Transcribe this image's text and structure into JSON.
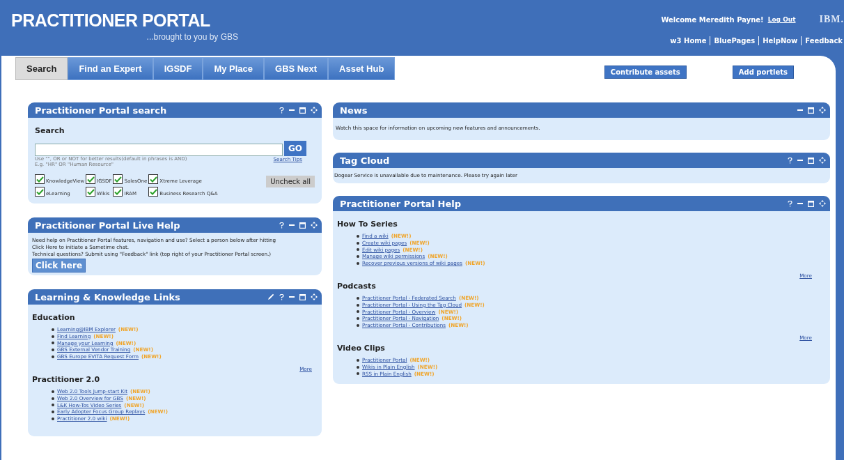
{
  "header": {
    "title": "PRACTITIONER PORTAL",
    "subtitle": "...brought to you by GBS",
    "welcome": "Welcome Meredith Payne!",
    "logout": "Log Out",
    "logo": "IBM.",
    "links": [
      "w3 Home",
      "BluePages",
      "HelpNow",
      "Feedback"
    ]
  },
  "tabs": [
    {
      "label": "Search",
      "selected": true
    },
    {
      "label": "Find an Expert",
      "selected": false
    },
    {
      "label": "IGSDF",
      "selected": false
    },
    {
      "label": "My Place",
      "selected": false
    },
    {
      "label": "GBS Next",
      "selected": false
    },
    {
      "label": "Asset Hub",
      "selected": false
    }
  ],
  "actions": [
    "Contribute assets",
    "Add portlets"
  ],
  "search_panel": {
    "title": "Practitioner Portal search",
    "controls": [
      {
        "kind": "help"
      },
      {
        "kind": "minimize"
      },
      {
        "kind": "maximize"
      },
      {
        "kind": "move"
      }
    ],
    "heading": "Search",
    "go": "GO",
    "hint": "Use \"\", OR or NOT for better results(default in phrases is AND)",
    "example": "E.g. \"HR\" OR \"Human Resource\"",
    "tips": "Search Tips",
    "uncheck_all": "Uncheck all",
    "sources": [
      {
        "label": "KnowledgeView",
        "checked": true
      },
      {
        "label": "IGSDF",
        "checked": true
      },
      {
        "label": "SalesOne",
        "checked": true
      },
      {
        "label": "Xtreme Leverage",
        "checked": true
      },
      {
        "label": "eLearning",
        "checked": true
      },
      {
        "label": "Wikis",
        "checked": true
      },
      {
        "label": "IRAM",
        "checked": true
      },
      {
        "label": "Business Research Q&A",
        "checked": true
      }
    ]
  },
  "live_help": {
    "title": "Practitioner Portal Live Help",
    "controls": [
      {
        "kind": "help"
      },
      {
        "kind": "minimize"
      },
      {
        "kind": "maximize"
      },
      {
        "kind": "move"
      }
    ],
    "lines": [
      "Need help on Practitioner Portal features, navigation and use? Select a person below after hitting",
      "Click Here to initiate a Sametime chat.",
      "Technical questions? Submit using \"Feedback\" link (top right of your Practitioner Portal screen.)"
    ],
    "button": "Click here"
  },
  "learning_links": {
    "title": "Learning & Knowledge Links",
    "controls": [
      {
        "kind": "edit"
      },
      {
        "kind": "help"
      },
      {
        "kind": "minimize"
      },
      {
        "kind": "maximize"
      },
      {
        "kind": "move"
      }
    ],
    "sections": [
      {
        "heading": "Education",
        "more": "More",
        "items": [
          {
            "link": "Learning@IBM Explorer",
            "badge": "(NEW!)"
          },
          {
            "link": "Find Learning",
            "badge": "(NEW!)"
          },
          {
            "link": "Manage your Learning",
            "badge": "(NEW!)"
          },
          {
            "link": "GBS External Vendor Training",
            "badge": "(NEW!)"
          },
          {
            "link": "GBS Europe EVITA Request Form",
            "badge": "(NEW!)"
          }
        ]
      },
      {
        "heading": "Practitioner 2.0",
        "items": [
          {
            "link": "Web 2.0 Tools Jump-start Kit",
            "badge": "(NEW!)"
          },
          {
            "link": "Web 2.0 Overview for GBS",
            "badge": "(NEW!)"
          },
          {
            "link": "L&K How-Tos Video Series",
            "badge": "(NEW!)"
          },
          {
            "link": "Early Adopter Focus Group Replays",
            "badge": "(NEW!)"
          },
          {
            "link": "Practitioner 2.0 wiki",
            "badge": "(NEW!)"
          }
        ]
      }
    ]
  },
  "news": {
    "title": "News",
    "controls": [
      {
        "kind": "minimize"
      },
      {
        "kind": "maximize"
      },
      {
        "kind": "move"
      }
    ],
    "text": "Watch this space for information on upcoming new features and announcements."
  },
  "tag_cloud": {
    "title": "Tag Cloud",
    "controls": [
      {
        "kind": "help"
      },
      {
        "kind": "minimize"
      },
      {
        "kind": "maximize"
      },
      {
        "kind": "move"
      }
    ],
    "text": "Dogear Service is unavailable due to maintenance. Please try again later"
  },
  "portal_help": {
    "title": "Practitioner Portal Help",
    "controls": [
      {
        "kind": "help"
      },
      {
        "kind": "minimize"
      },
      {
        "kind": "maximize"
      },
      {
        "kind": "move"
      }
    ],
    "sections": [
      {
        "heading": "How To Series",
        "more": "More",
        "items": [
          {
            "link": "Find a wiki",
            "badge": "(NEW!)"
          },
          {
            "link": "Create wiki pages",
            "badge": "(NEW!)"
          },
          {
            "link": "Edit wiki pages",
            "badge": "(NEW!)"
          },
          {
            "link": "Manage wiki permissions",
            "badge": "(NEW!)"
          },
          {
            "link": "Recover previous versions of wiki pages",
            "badge": "(NEW!)"
          }
        ]
      },
      {
        "heading": "Podcasts",
        "more": "More",
        "items": [
          {
            "link": "Practitioner Portal - Federated Search",
            "badge": "(NEW!)"
          },
          {
            "link": "Practitioner Portal - Using the Tag Cloud",
            "badge": "(NEW!)"
          },
          {
            "link": "Practitioner Portal - Overview",
            "badge": "(NEW!)"
          },
          {
            "link": "Practitioner Portal - Navigation",
            "badge": "(NEW!)"
          },
          {
            "link": "Practitioner Portal - Contributions",
            "badge": "(NEW!)"
          }
        ]
      },
      {
        "heading": "Video Clips",
        "items": [
          {
            "link": "Practitioner Portal",
            "badge": "(NEW!)"
          },
          {
            "link": "Wikis in Plain English",
            "badge": "(NEW!)"
          },
          {
            "link": "RSS in Plain English",
            "badge": "(NEW!)"
          }
        ]
      }
    ]
  }
}
